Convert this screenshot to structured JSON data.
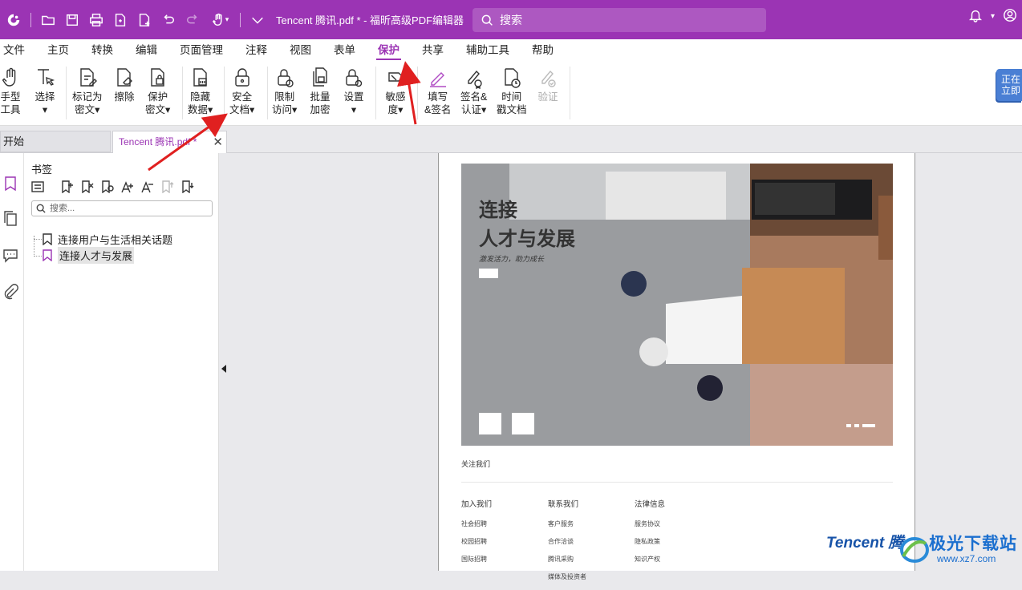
{
  "titlebar": {
    "doc_title": "Tencent 腾讯.pdf * - 福昕高级PDF编辑器",
    "search_placeholder": "搜索"
  },
  "menu": {
    "items": [
      "文件",
      "主页",
      "转换",
      "编辑",
      "页面管理",
      "注释",
      "视图",
      "表单",
      "保护",
      "共享",
      "辅助工具",
      "帮助"
    ],
    "active": "保护"
  },
  "ribbon": {
    "hand_tool": [
      "手型",
      "工具"
    ],
    "select": [
      "选择",
      "▾"
    ],
    "mark_redact": [
      "标记为",
      "密文▾"
    ],
    "erase": [
      "擦除",
      ""
    ],
    "protect_redact": [
      "保护",
      "密文▾"
    ],
    "hide_data": [
      "隐藏",
      "数据▾"
    ],
    "secure_doc": [
      "安全",
      "文档▾"
    ],
    "restrict_access": [
      "限制",
      "访问▾"
    ],
    "batch_encrypt": [
      "批量",
      "加密"
    ],
    "settings": [
      "设置",
      "▾"
    ],
    "sensitivity": [
      "敏感",
      "度▾"
    ],
    "fill_sign": [
      "填写",
      "&签名"
    ],
    "sign_certify": [
      "签名&",
      "认证▾"
    ],
    "timestamp": [
      "时间",
      "戳文档"
    ],
    "verify": [
      "验证",
      ""
    ],
    "promo": [
      "正在",
      "立即"
    ]
  },
  "tabs": {
    "start": "开始",
    "doc": "Tencent 腾讯.pdf *",
    "close": "✕"
  },
  "bookmarks": {
    "title": "书签",
    "search_placeholder": "搜索...",
    "items": [
      "连接用户与生活相关话题",
      "连接人才与发展"
    ]
  },
  "page": {
    "hero_line1": "连接",
    "hero_line2": "人才与发展",
    "hero_sub": "激发活力，助力成长",
    "follow": "关注我们",
    "col1": {
      "head": "加入我们",
      "links": [
        "社会招聘",
        "校园招聘",
        "国际招聘"
      ]
    },
    "col2": {
      "head": "联系我们",
      "links": [
        "客户服务",
        "合作洽谈",
        "腾讯采购",
        "媒体及投资者"
      ]
    },
    "col3": {
      "head": "法律信息",
      "links": [
        "服务协议",
        "隐私政策",
        "知识产权"
      ]
    },
    "logo": "Tencent 腾"
  },
  "watermark": {
    "name": "极光下载站",
    "url": "www.xz7.com"
  },
  "colors": {
    "brand": "#9b34b4",
    "arrow": "#e02020"
  }
}
